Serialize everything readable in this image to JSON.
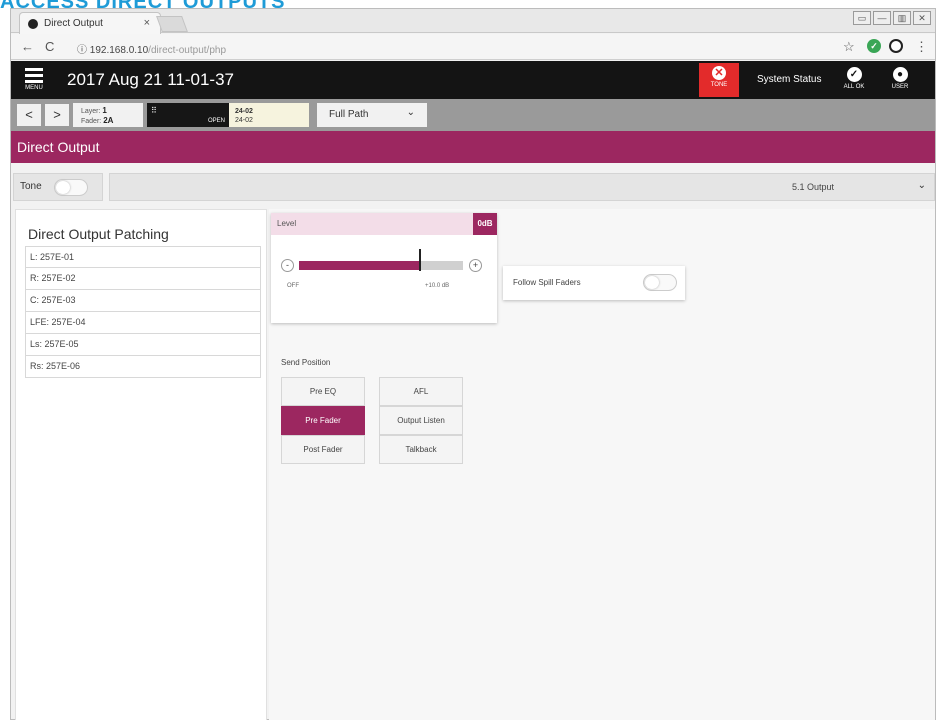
{
  "doc": {
    "heading": "ACCESS DIRECT OUTPUTS"
  },
  "browser": {
    "tab_title": "Direct Output",
    "tab_close": "×",
    "url_host": "192.168.0.10",
    "url_path": "/direct-output/php",
    "nav_back": "←",
    "nav_reload": "C",
    "url_info": "ⓘ",
    "bookmark": "☆",
    "window_buttons": [
      "▭",
      "—",
      "▥",
      "✕"
    ]
  },
  "topbar": {
    "menu_label": "MENU",
    "datetime": "2017 Aug 21 11-01-37",
    "tone_label": "TONE",
    "system_status": "System Status",
    "all_ok_label": "ALL OK",
    "user_label": "USER"
  },
  "secbar": {
    "prev": "<",
    "next": ">",
    "layer_label": "Layer:",
    "layer_value": "1",
    "fader_label": "Fader:",
    "fader_value": "2A",
    "open_label": "OPEN",
    "path_top": "24-02",
    "path_bottom": "24-02",
    "path_mode": "Full Path",
    "chevron": "⌄"
  },
  "page": {
    "title": "Direct Output",
    "tone_label": "Tone",
    "output_select": "5.1 Output"
  },
  "patching": {
    "title": "Direct Output Patching",
    "rows": [
      "L:  257E-01",
      "R:  257E-02",
      "C:  257E-03",
      "LFE: 257E-04",
      "Ls:  257E-05",
      "Rs:  257E-06"
    ]
  },
  "level": {
    "label": "Level",
    "badge": "0dB",
    "minus": "-",
    "plus": "+",
    "min_label": "OFF",
    "max_label": "+10.0 dB",
    "fill_fraction": 0.73
  },
  "follow": {
    "label": "Follow Spill Faders"
  },
  "send_position": {
    "label": "Send Position",
    "buttons": [
      [
        "Pre EQ",
        "AFL"
      ],
      [
        "Pre Fader",
        "Output Listen"
      ],
      [
        "Post Fader",
        "Talkback"
      ]
    ],
    "active": "Pre Fader"
  },
  "colors": {
    "accent": "#9c2760",
    "tone_red": "#e32b2b",
    "heading_blue": "#1e9bd7"
  }
}
